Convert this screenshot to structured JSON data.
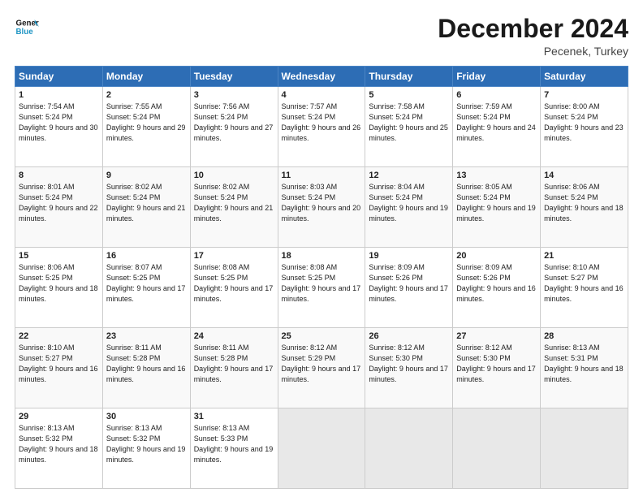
{
  "header": {
    "logo_line1": "General",
    "logo_line2": "Blue",
    "title": "December 2024",
    "subtitle": "Pecenek, Turkey"
  },
  "days_of_week": [
    "Sunday",
    "Monday",
    "Tuesday",
    "Wednesday",
    "Thursday",
    "Friday",
    "Saturday"
  ],
  "weeks": [
    [
      {
        "day": "1",
        "sunrise": "7:54 AM",
        "sunset": "5:24 PM",
        "daylight": "9 hours and 30 minutes."
      },
      {
        "day": "2",
        "sunrise": "7:55 AM",
        "sunset": "5:24 PM",
        "daylight": "9 hours and 29 minutes."
      },
      {
        "day": "3",
        "sunrise": "7:56 AM",
        "sunset": "5:24 PM",
        "daylight": "9 hours and 27 minutes."
      },
      {
        "day": "4",
        "sunrise": "7:57 AM",
        "sunset": "5:24 PM",
        "daylight": "9 hours and 26 minutes."
      },
      {
        "day": "5",
        "sunrise": "7:58 AM",
        "sunset": "5:24 PM",
        "daylight": "9 hours and 25 minutes."
      },
      {
        "day": "6",
        "sunrise": "7:59 AM",
        "sunset": "5:24 PM",
        "daylight": "9 hours and 24 minutes."
      },
      {
        "day": "7",
        "sunrise": "8:00 AM",
        "sunset": "5:24 PM",
        "daylight": "9 hours and 23 minutes."
      }
    ],
    [
      {
        "day": "8",
        "sunrise": "8:01 AM",
        "sunset": "5:24 PM",
        "daylight": "9 hours and 22 minutes."
      },
      {
        "day": "9",
        "sunrise": "8:02 AM",
        "sunset": "5:24 PM",
        "daylight": "9 hours and 21 minutes."
      },
      {
        "day": "10",
        "sunrise": "8:02 AM",
        "sunset": "5:24 PM",
        "daylight": "9 hours and 21 minutes."
      },
      {
        "day": "11",
        "sunrise": "8:03 AM",
        "sunset": "5:24 PM",
        "daylight": "9 hours and 20 minutes."
      },
      {
        "day": "12",
        "sunrise": "8:04 AM",
        "sunset": "5:24 PM",
        "daylight": "9 hours and 19 minutes."
      },
      {
        "day": "13",
        "sunrise": "8:05 AM",
        "sunset": "5:24 PM",
        "daylight": "9 hours and 19 minutes."
      },
      {
        "day": "14",
        "sunrise": "8:06 AM",
        "sunset": "5:24 PM",
        "daylight": "9 hours and 18 minutes."
      }
    ],
    [
      {
        "day": "15",
        "sunrise": "8:06 AM",
        "sunset": "5:25 PM",
        "daylight": "9 hours and 18 minutes."
      },
      {
        "day": "16",
        "sunrise": "8:07 AM",
        "sunset": "5:25 PM",
        "daylight": "9 hours and 17 minutes."
      },
      {
        "day": "17",
        "sunrise": "8:08 AM",
        "sunset": "5:25 PM",
        "daylight": "9 hours and 17 minutes."
      },
      {
        "day": "18",
        "sunrise": "8:08 AM",
        "sunset": "5:25 PM",
        "daylight": "9 hours and 17 minutes."
      },
      {
        "day": "19",
        "sunrise": "8:09 AM",
        "sunset": "5:26 PM",
        "daylight": "9 hours and 17 minutes."
      },
      {
        "day": "20",
        "sunrise": "8:09 AM",
        "sunset": "5:26 PM",
        "daylight": "9 hours and 16 minutes."
      },
      {
        "day": "21",
        "sunrise": "8:10 AM",
        "sunset": "5:27 PM",
        "daylight": "9 hours and 16 minutes."
      }
    ],
    [
      {
        "day": "22",
        "sunrise": "8:10 AM",
        "sunset": "5:27 PM",
        "daylight": "9 hours and 16 minutes."
      },
      {
        "day": "23",
        "sunrise": "8:11 AM",
        "sunset": "5:28 PM",
        "daylight": "9 hours and 16 minutes."
      },
      {
        "day": "24",
        "sunrise": "8:11 AM",
        "sunset": "5:28 PM",
        "daylight": "9 hours and 17 minutes."
      },
      {
        "day": "25",
        "sunrise": "8:12 AM",
        "sunset": "5:29 PM",
        "daylight": "9 hours and 17 minutes."
      },
      {
        "day": "26",
        "sunrise": "8:12 AM",
        "sunset": "5:30 PM",
        "daylight": "9 hours and 17 minutes."
      },
      {
        "day": "27",
        "sunrise": "8:12 AM",
        "sunset": "5:30 PM",
        "daylight": "9 hours and 17 minutes."
      },
      {
        "day": "28",
        "sunrise": "8:13 AM",
        "sunset": "5:31 PM",
        "daylight": "9 hours and 18 minutes."
      }
    ],
    [
      {
        "day": "29",
        "sunrise": "8:13 AM",
        "sunset": "5:32 PM",
        "daylight": "9 hours and 18 minutes."
      },
      {
        "day": "30",
        "sunrise": "8:13 AM",
        "sunset": "5:32 PM",
        "daylight": "9 hours and 19 minutes."
      },
      {
        "day": "31",
        "sunrise": "8:13 AM",
        "sunset": "5:33 PM",
        "daylight": "9 hours and 19 minutes."
      },
      null,
      null,
      null,
      null
    ]
  ]
}
